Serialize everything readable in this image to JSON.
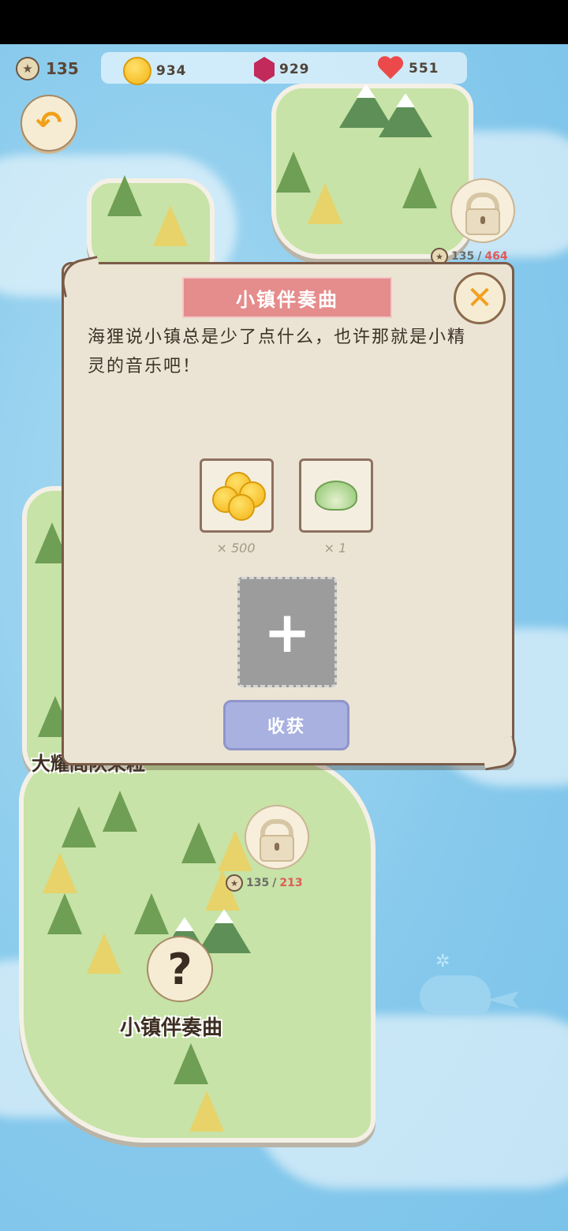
{
  "status": {
    "stars": "135",
    "coins": "934",
    "gems": "929",
    "hearts": "551"
  },
  "map": {
    "locks": [
      {
        "current": "135",
        "separator": "/",
        "required": "464"
      },
      {
        "current": "135",
        "separator": "/",
        "required": "213"
      }
    ],
    "labels": {
      "region_top": "大耀阁队采粒",
      "quest_node": "小镇伴奏曲"
    },
    "quest_symbol": "?"
  },
  "dialog": {
    "title": "小镇伴奏曲",
    "close_symbol": "✕",
    "description": "海狸说小镇总是少了点什么，也许那就是小精灵的音乐吧！",
    "rewards": [
      {
        "icon": "gold-coins-icon",
        "quantity": "× 500"
      },
      {
        "icon": "cabbage-icon",
        "quantity": "× 1"
      }
    ],
    "add_symbol": "+",
    "harvest_label": "收获"
  },
  "colors": {
    "title_bar": "#e58c8c",
    "harvest_button": "#a8b1e0",
    "panel": "#ebe4d4",
    "lock_required": "#e05a5a"
  }
}
